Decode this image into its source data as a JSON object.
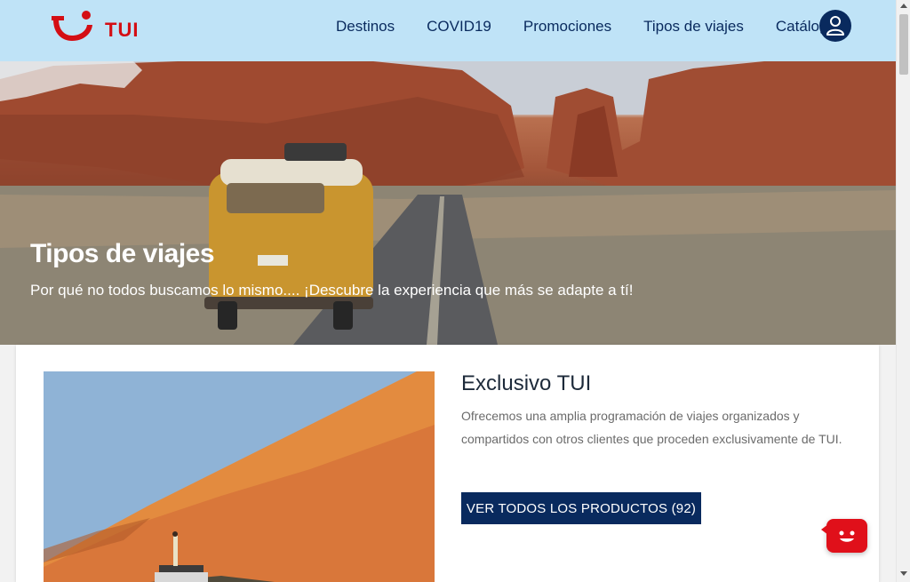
{
  "header": {
    "logo_text": "TUI",
    "nav": [
      "Destinos",
      "COVID19",
      "Promociones",
      "Tipos de viajes",
      "Catálogos"
    ]
  },
  "hero": {
    "title": "Tipos de viajes",
    "subtitle": "Por qué no todos buscamos lo mismo.... ¡Descubre la experiencia que más se adapte a tí!"
  },
  "card": {
    "title": "Exclusivo TUI",
    "description": "Ofrecemos una amplia programación de viajes organizados y compartidos con otros clientes que proceden exclusivamente de TUI.",
    "button_label": "VER TODOS LOS PRODUCTOS (92)"
  },
  "colors": {
    "brand_red": "#d40e14",
    "navy": "#092a5e",
    "header_bg": "#bfe3f7"
  },
  "icons": {
    "logo": "tui-smile-logo",
    "account": "user-account-icon",
    "chat": "chat-bot-icon"
  }
}
